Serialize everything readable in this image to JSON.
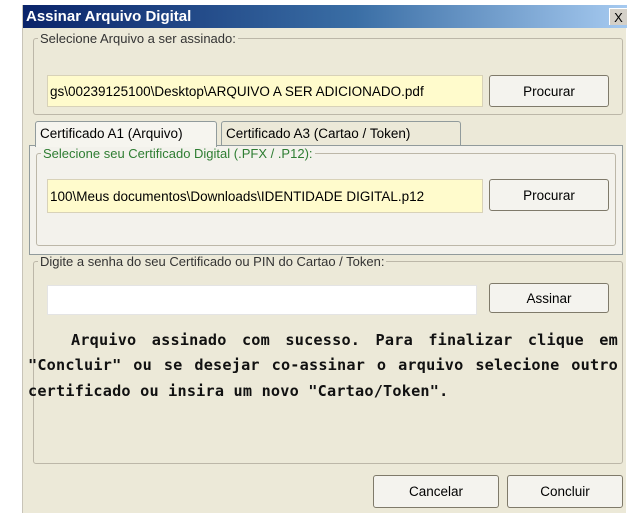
{
  "window": {
    "title": "Assinar Arquivo Digital",
    "close_label": "X"
  },
  "file_section": {
    "legend": "Selecione Arquivo a ser assinado:",
    "path": "gs\\00239125100\\Desktop\\ARQUIVO A SER ADICIONADO.pdf",
    "browse_label": "Procurar"
  },
  "tabs": [
    {
      "label": "Certificado A1 (Arquivo)",
      "active": true
    },
    {
      "label": "Certificado A3 (Cartao / Token)",
      "active": false
    }
  ],
  "certificate_section": {
    "legend": "Selecione seu Certificado Digital (.PFX / .P12):",
    "legend_color": "#2e7d32",
    "path": "100\\Meus documentos\\Downloads\\IDENTIDADE DIGITAL.p12",
    "browse_label": "Procurar"
  },
  "password_section": {
    "legend": "Digite a senha do seu Certificado ou PIN do Cartao / Token:",
    "value": "",
    "sign_label": "Assinar"
  },
  "status_message": "Arquivo assinado com sucesso. Para finalizar clique em \"Concluir\" ou se desejar co-assinar o arquivo selecione outro certificado ou insira um novo \"Cartao/Token\".",
  "footer": {
    "cancel_label": "Cancelar",
    "finish_label": "Concluir"
  },
  "colors": {
    "title_bar_start": "#0a246a",
    "title_bar_end": "#a6caf0",
    "field_highlight": "#fffbcc",
    "dialog_background": "#ece9d8"
  }
}
